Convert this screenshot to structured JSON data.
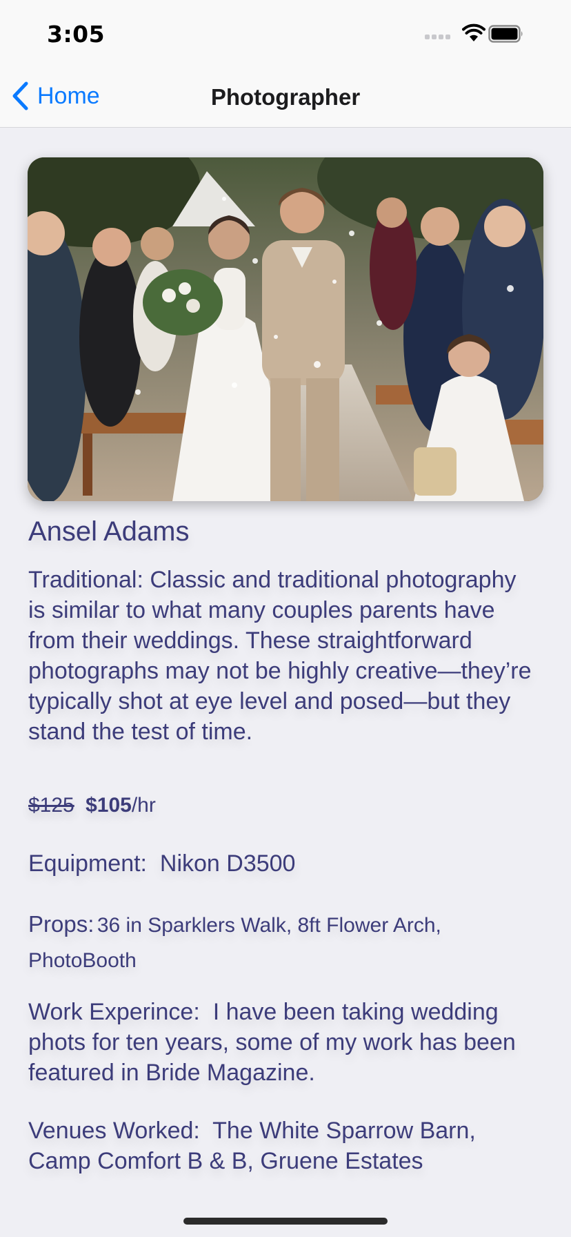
{
  "status_bar": {
    "time": "3:05",
    "icons": [
      "cellular-signal-icon",
      "wifi-icon",
      "battery-icon"
    ]
  },
  "nav": {
    "back_label": "Home",
    "back_icon": "chevron-left-icon",
    "title": "Photographer"
  },
  "photographer": {
    "image": "wedding-couple-photo",
    "name": "Ansel Adams",
    "description": "Traditional: Classic and traditional photography is similar to what many couples parents have from their weddings. These straightforward photographs may not be highly creative—they’re typically shot at eye level and posed—but they stand the test of time.",
    "price_old": "$125",
    "price_new": "$105",
    "price_unit": "/hr",
    "equipment_label": "Equipment:",
    "equipment_value": "Nikon D3500",
    "props_label": "Props:",
    "props_value": "36 in Sparklers Walk, 8ft Flower Arch, PhotoBooth",
    "experience_label": "Work Experince:",
    "experience_value": "I have been taking wedding phots for ten years, some of my work has been featured in Bride Magazine.",
    "venues_label": "Venues Worked:",
    "venues_value": "The White Sparrow Barn, Camp Comfort B & B, Gruene Estates"
  },
  "colors": {
    "accent": "#0a7aff",
    "text": "#3c3c7a",
    "background": "#efeff4",
    "bar": "#f9f9f9"
  }
}
